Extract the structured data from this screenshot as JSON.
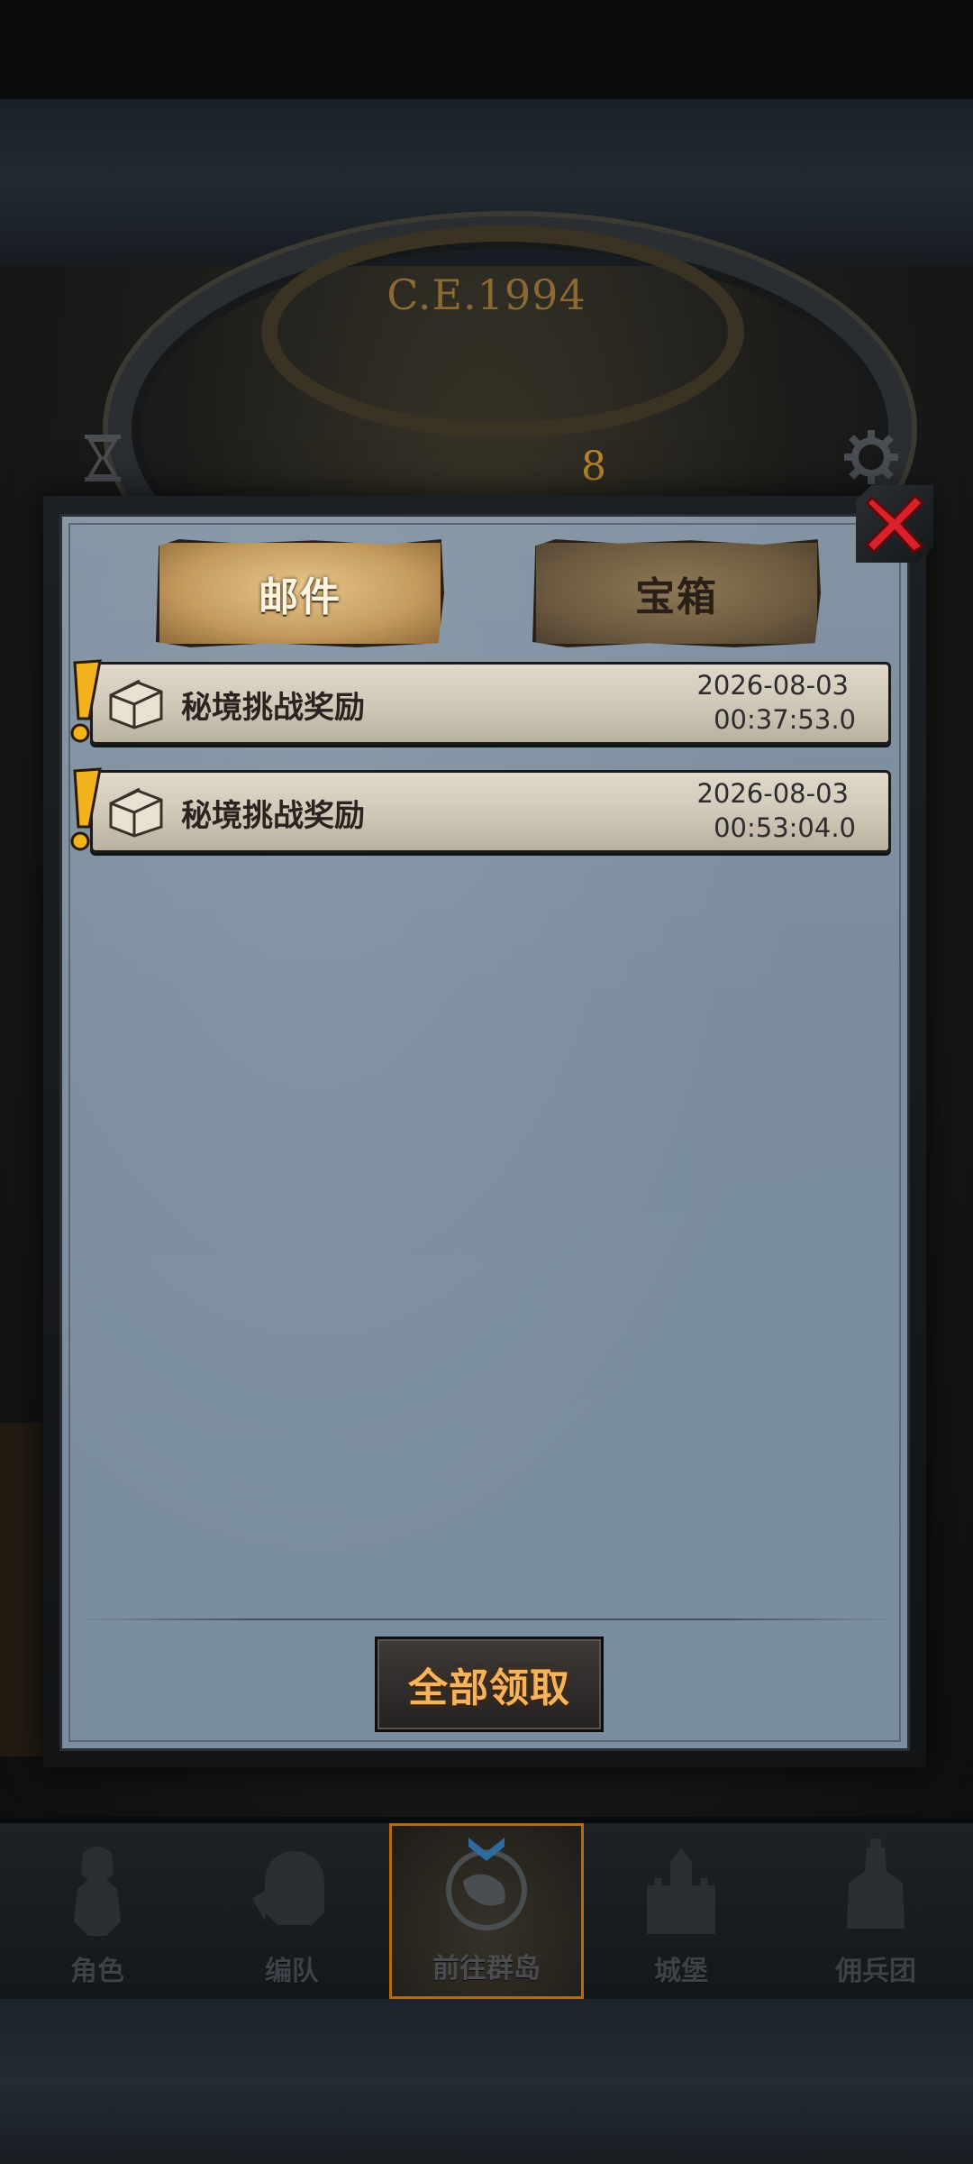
{
  "header": {
    "era": "C.E.1994",
    "dial_highlight": "8"
  },
  "tabs": [
    {
      "label": "邮件",
      "active": true
    },
    {
      "label": "宝箱",
      "active": false
    }
  ],
  "mails": [
    {
      "title": "秘境挑战奖励",
      "date": "2026-08-03",
      "time": "00:37:53.0",
      "icon": "chest-icon",
      "unread": true
    },
    {
      "title": "秘境挑战奖励",
      "date": "2026-08-03",
      "time": "00:53:04.0",
      "icon": "chest-icon",
      "unread": true
    }
  ],
  "actions": {
    "claim_all": "全部领取"
  },
  "bottom_nav": [
    {
      "label": "角色",
      "icon": "knight-icon"
    },
    {
      "label": "编队",
      "icon": "helmet-icon"
    },
    {
      "label": "前往群岛",
      "icon": "globe-icon",
      "active": true
    },
    {
      "label": "城堡",
      "icon": "castle-icon"
    },
    {
      "label": "佣兵团",
      "icon": "mercenary-icon"
    }
  ],
  "colors": {
    "accent": "#f4b35d",
    "close": "#d8212a",
    "alert": "#f2b21e",
    "active_nav_border": "#b76a14"
  }
}
